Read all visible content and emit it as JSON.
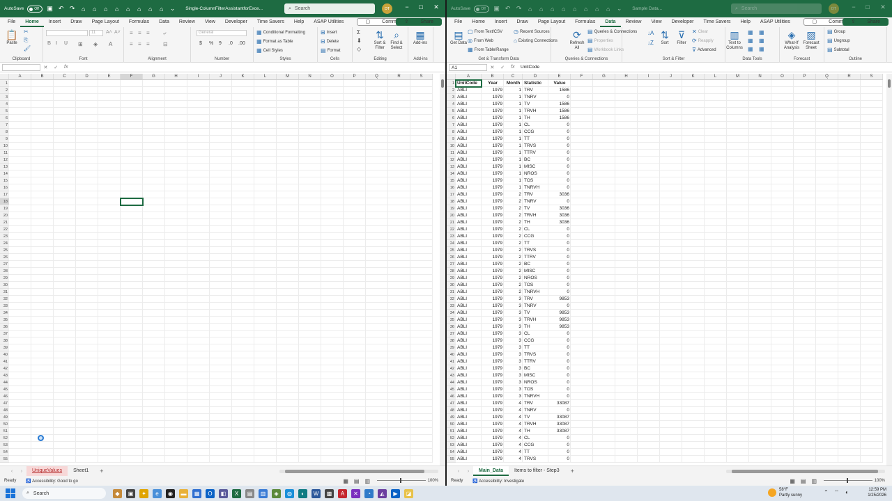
{
  "left_window": {
    "autosave_label": "AutoSave",
    "autosave_state": "Off",
    "title": "Single-ColumnFilterAssistantforExce...",
    "search_placeholder": "Search",
    "user_initials": "DT",
    "menu": [
      "File",
      "Home",
      "Insert",
      "Draw",
      "Page Layout",
      "Formulas",
      "Data",
      "Review",
      "View",
      "Developer",
      "Time Savers",
      "Help",
      "ASAP Utilities"
    ],
    "active_menu": "Home",
    "comments_label": "Comments",
    "share_label": "Share",
    "ribbon": {
      "clipboard": {
        "name": "Clipboard",
        "paste": "Paste"
      },
      "font": {
        "name": "Font",
        "family": "",
        "size": "11"
      },
      "alignment": {
        "name": "Alignment"
      },
      "number": {
        "name": "Number",
        "format": "General"
      },
      "styles": {
        "name": "Styles",
        "conditional_formatting": "Conditional Formatting",
        "format_as_table": "Format as Table",
        "cell_styles": "Cell Styles"
      },
      "cells": {
        "name": "Cells",
        "insert": "Insert",
        "delete": "Delete",
        "format": "Format"
      },
      "editing": {
        "name": "Editing",
        "sort_filter": "Sort & Filter",
        "find_select": "Find & Select"
      },
      "addins": {
        "name": "Add-ins",
        "addins": "Add-ins"
      }
    },
    "name_box": "",
    "formula": "",
    "columns": [
      "A",
      "B",
      "C",
      "D",
      "E",
      "F",
      "G",
      "H",
      "I",
      "J",
      "K",
      "L",
      "M",
      "N",
      "O",
      "P",
      "Q",
      "R",
      "S"
    ],
    "row_count": 55,
    "sheets": [
      "UniqueValues",
      "Sheet1"
    ],
    "active_sheet": "UniqueValues",
    "status_ready": "Ready",
    "accessibility": "Accessibility: Good to go",
    "zoom": "100%"
  },
  "right_window": {
    "autosave_label": "AutoSave",
    "autosave_state": "Off",
    "title": "Sample Data...",
    "search_placeholder": "Search",
    "user_initials": "DT",
    "menu": [
      "File",
      "Home",
      "Insert",
      "Draw",
      "Page Layout",
      "Formulas",
      "Data",
      "Review",
      "View",
      "Developer",
      "Time Savers",
      "Help",
      "ASAP Utilities"
    ],
    "active_menu": "Data",
    "comments_label": "Comments",
    "share_label": "Share",
    "ribbon": {
      "get_transform": {
        "name": "Get & Transform Data",
        "get_data": "Get Data",
        "from_text": "From Text/CSV",
        "from_web": "From Web",
        "from_table": "From Table/Range",
        "recent_sources": "Recent Sources",
        "existing_connections": "Existing Connections"
      },
      "queries": {
        "name": "Queries & Connections",
        "queries_connections": "Queries & Connections",
        "properties": "Properties",
        "workbook_links": "Workbook Links",
        "refresh_all": "Refresh All"
      },
      "sort_filter": {
        "name": "Sort & Filter",
        "sort": "Sort",
        "filter": "Filter",
        "clear": "Clear",
        "reapply": "Reapply",
        "advanced": "Advanced"
      },
      "data_tools": {
        "name": "Data Tools",
        "text_to_columns": "Text to Columns"
      },
      "forecast": {
        "name": "Forecast",
        "what_if": "What-If Analysis",
        "forecast_sheet": "Forecast Sheet"
      },
      "outline": {
        "name": "Outline",
        "group": "Group",
        "ungroup": "Ungroup",
        "subtotal": "Subtotal"
      }
    },
    "name_box": "A1",
    "formula": "UnitCode",
    "columns": [
      "A",
      "B",
      "C",
      "D",
      "E",
      "F",
      "G",
      "H",
      "I",
      "J",
      "K",
      "L",
      "M",
      "N",
      "O",
      "P",
      "Q",
      "R",
      "S"
    ],
    "table": {
      "headers": [
        "UnitCode",
        "Year",
        "Month",
        "Statistic",
        "Value"
      ],
      "rows": [
        [
          "ABLI",
          "1979",
          "1",
          "TRV",
          "1586"
        ],
        [
          "ABLI",
          "1979",
          "1",
          "TNRV",
          "0"
        ],
        [
          "ABLI",
          "1979",
          "1",
          "TV",
          "1586"
        ],
        [
          "ABLI",
          "1979",
          "1",
          "TRVH",
          "1586"
        ],
        [
          "ABLI",
          "1979",
          "1",
          "TH",
          "1586"
        ],
        [
          "ABLI",
          "1979",
          "1",
          "CL",
          "0"
        ],
        [
          "ABLI",
          "1979",
          "1",
          "CCG",
          "0"
        ],
        [
          "ABLI",
          "1979",
          "1",
          "TT",
          "0"
        ],
        [
          "ABLI",
          "1979",
          "1",
          "TRVS",
          "0"
        ],
        [
          "ABLI",
          "1979",
          "1",
          "TTRV",
          "0"
        ],
        [
          "ABLI",
          "1979",
          "1",
          "BC",
          "0"
        ],
        [
          "ABLI",
          "1979",
          "1",
          "MISC",
          "0"
        ],
        [
          "ABLI",
          "1979",
          "1",
          "NROS",
          "0"
        ],
        [
          "ABLI",
          "1979",
          "1",
          "TOS",
          "0"
        ],
        [
          "ABLI",
          "1979",
          "1",
          "TNRVH",
          "0"
        ],
        [
          "ABLI",
          "1979",
          "2",
          "TRV",
          "3036"
        ],
        [
          "ABLI",
          "1979",
          "2",
          "TNRV",
          "0"
        ],
        [
          "ABLI",
          "1979",
          "2",
          "TV",
          "3036"
        ],
        [
          "ABLI",
          "1979",
          "2",
          "TRVH",
          "3036"
        ],
        [
          "ABLI",
          "1979",
          "2",
          "TH",
          "3036"
        ],
        [
          "ABLI",
          "1979",
          "2",
          "CL",
          "0"
        ],
        [
          "ABLI",
          "1979",
          "2",
          "CCG",
          "0"
        ],
        [
          "ABLI",
          "1979",
          "2",
          "TT",
          "0"
        ],
        [
          "ABLI",
          "1979",
          "2",
          "TRVS",
          "0"
        ],
        [
          "ABLI",
          "1979",
          "2",
          "TTRV",
          "0"
        ],
        [
          "ABLI",
          "1979",
          "2",
          "BC",
          "0"
        ],
        [
          "ABLI",
          "1979",
          "2",
          "MISC",
          "0"
        ],
        [
          "ABLI",
          "1979",
          "2",
          "NROS",
          "0"
        ],
        [
          "ABLI",
          "1979",
          "2",
          "TOS",
          "0"
        ],
        [
          "ABLI",
          "1979",
          "2",
          "TNRVH",
          "0"
        ],
        [
          "ABLI",
          "1979",
          "3",
          "TRV",
          "9853"
        ],
        [
          "ABLI",
          "1979",
          "3",
          "TNRV",
          "0"
        ],
        [
          "ABLI",
          "1979",
          "3",
          "TV",
          "9853"
        ],
        [
          "ABLI",
          "1979",
          "3",
          "TRVH",
          "9853"
        ],
        [
          "ABLI",
          "1979",
          "3",
          "TH",
          "9853"
        ],
        [
          "ABLI",
          "1979",
          "3",
          "CL",
          "0"
        ],
        [
          "ABLI",
          "1979",
          "3",
          "CCG",
          "0"
        ],
        [
          "ABLI",
          "1979",
          "3",
          "TT",
          "0"
        ],
        [
          "ABLI",
          "1979",
          "3",
          "TRVS",
          "0"
        ],
        [
          "ABLI",
          "1979",
          "3",
          "TTRV",
          "0"
        ],
        [
          "ABLI",
          "1979",
          "3",
          "BC",
          "0"
        ],
        [
          "ABLI",
          "1979",
          "3",
          "MISC",
          "0"
        ],
        [
          "ABLI",
          "1979",
          "3",
          "NROS",
          "0"
        ],
        [
          "ABLI",
          "1979",
          "3",
          "TOS",
          "0"
        ],
        [
          "ABLI",
          "1979",
          "3",
          "TNRVH",
          "0"
        ],
        [
          "ABLI",
          "1979",
          "4",
          "TRV",
          "33087"
        ],
        [
          "ABLI",
          "1979",
          "4",
          "TNRV",
          "0"
        ],
        [
          "ABLI",
          "1979",
          "4",
          "TV",
          "33087"
        ],
        [
          "ABLI",
          "1979",
          "4",
          "TRVH",
          "33087"
        ],
        [
          "ABLI",
          "1979",
          "4",
          "TH",
          "33087"
        ],
        [
          "ABLI",
          "1979",
          "4",
          "CL",
          "0"
        ],
        [
          "ABLI",
          "1979",
          "4",
          "CCG",
          "0"
        ],
        [
          "ABLI",
          "1979",
          "4",
          "TT",
          "0"
        ],
        [
          "ABLI",
          "1979",
          "4",
          "TRVS",
          "0"
        ]
      ]
    },
    "sheets": [
      "Main_Data",
      "Items to filter - Step3"
    ],
    "active_sheet": "Main_Data",
    "status_ready": "Ready",
    "accessibility": "Accessibility: Investigate",
    "zoom": "100%"
  },
  "taskbar": {
    "search": "Search",
    "weather_temp": "58°F",
    "weather_desc": "Partly sunny",
    "time": "12:59 PM",
    "date": "1/25/2026"
  }
}
